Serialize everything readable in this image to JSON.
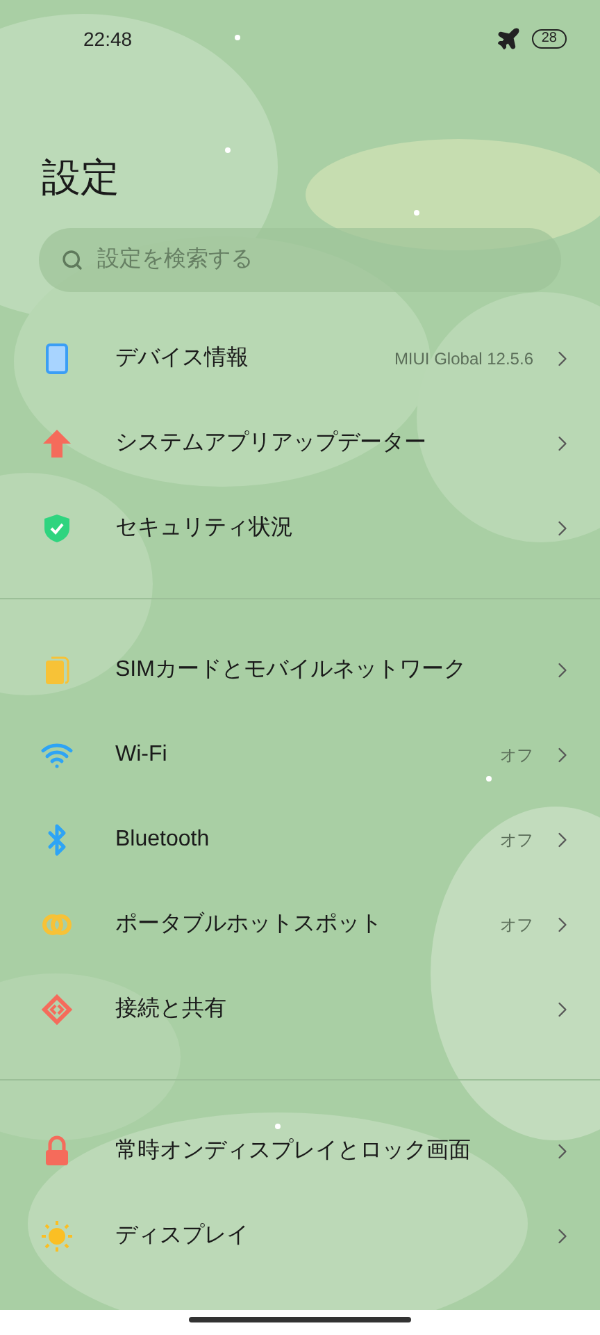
{
  "status_bar": {
    "time": "22:48",
    "battery": "28"
  },
  "title": "設定",
  "search": {
    "placeholder": "設定を検索する"
  },
  "groups": [
    {
      "items": [
        {
          "label": "デバイス情報",
          "value": "MIUI Global 12.5.6"
        },
        {
          "label": "システムアプリアップデーター"
        },
        {
          "label": "セキュリティ状況"
        }
      ]
    },
    {
      "items": [
        {
          "label": "SIMカードとモバイルネットワーク"
        },
        {
          "label": "Wi-Fi",
          "value": "オフ"
        },
        {
          "label": "Bluetooth",
          "value": "オフ"
        },
        {
          "label": "ポータブルホットスポット",
          "value": "オフ"
        },
        {
          "label": "接続と共有"
        }
      ]
    },
    {
      "items": [
        {
          "label": "常時オンディスプレイとロック画面"
        },
        {
          "label": "ディスプレイ"
        }
      ]
    }
  ]
}
